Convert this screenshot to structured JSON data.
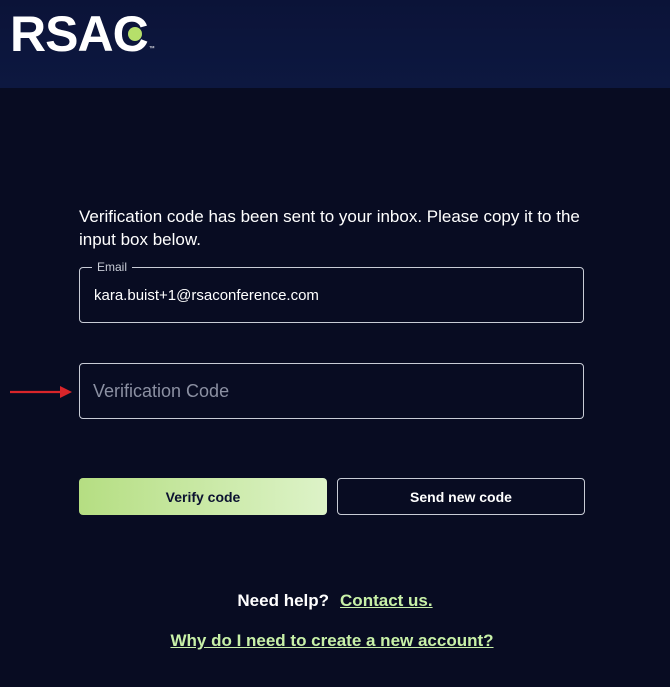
{
  "header": {
    "logo_text_main": "RSA",
    "logo_text_c": "C",
    "logo_tm": "™",
    "accent_color": "#b6df6a"
  },
  "form": {
    "intro_text": "Verification code has been sent to your inbox. Please copy it to the input box below.",
    "email_label": "Email",
    "email_value": "kara.buist+1@rsaconference.com",
    "code_placeholder": "Verification Code",
    "code_value": ""
  },
  "buttons": {
    "verify_label": "Verify code",
    "send_new_label": "Send new code"
  },
  "help": {
    "prompt": "Need help?",
    "contact_link": "Contact us.",
    "why_link": "Why do I need to create a new account?"
  },
  "annotation": {
    "arrow_color": "#d9252a"
  }
}
